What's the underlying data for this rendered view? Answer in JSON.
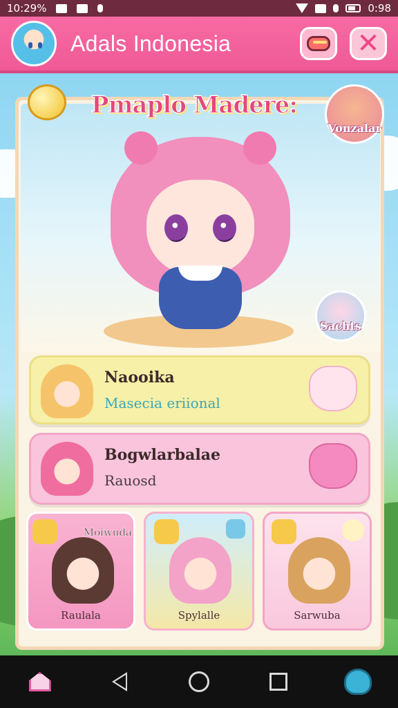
{
  "status_bar": {
    "time": "10:29%",
    "right_text": "0:98"
  },
  "header": {
    "title": "Adals Indonesia",
    "chat_icon": "chat-bubble-icon",
    "close_icon": "close-icon"
  },
  "game": {
    "title": "Pmaplo Madere:",
    "variety_button": "Vonzalar",
    "sachets_button": "Sachts"
  },
  "cards": [
    {
      "name": "Naooika",
      "subtitle": "Masecia eriional"
    },
    {
      "name": "Bogwlarbalae",
      "subtitle": "Rauosd"
    }
  ],
  "tiles": [
    {
      "label": "Raulala",
      "top_label": "Moiwuda"
    },
    {
      "label": "Spylalle"
    },
    {
      "label": "Sarwuba"
    }
  ],
  "nav": {
    "items": [
      "home-icon",
      "back-icon",
      "home-circle-icon",
      "recents-icon",
      "character-icon"
    ]
  },
  "colors": {
    "header_pink": "#ef5a96",
    "panel_cream": "#fbf3e4",
    "card_yellow": "#f6f0a8",
    "card_pink": "#f9c4dc"
  }
}
